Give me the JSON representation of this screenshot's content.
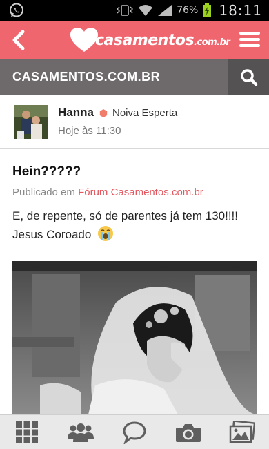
{
  "status_bar": {
    "battery_percent": "76%",
    "time": "18:11",
    "icons": [
      "whatsapp-icon",
      "vibrate-icon",
      "wifi-icon",
      "signal-icon",
      "battery-icon"
    ]
  },
  "app_header": {
    "brand": "casamentos",
    "brand_suffix": ".com.br",
    "icons": [
      "back-arrow-icon",
      "heart-logo-icon",
      "hamburger-menu-icon"
    ]
  },
  "section": {
    "title": "CASAMENTOS.COM.BR",
    "icon": "search-icon"
  },
  "author": {
    "name": "Hanna",
    "badge": "Noiva Esperta",
    "posted": "Hoje às 11:30"
  },
  "post": {
    "title": "Hein?????",
    "published_prefix": "Publicado em",
    "forum_link": "Fórum Casamentos.com.br",
    "body_line1": "E, de repente, só de parentes já tem 130!!!!",
    "body_line2": "Jesus Coroado",
    "emoji": "crying-emoji-icon"
  },
  "bottom_nav": {
    "icons": [
      "grid-icon",
      "community-icon",
      "chat-icon",
      "camera-icon",
      "photos-icon"
    ]
  },
  "colors": {
    "brand": "#f0666f",
    "section_bar": "#6e6a6c",
    "link": "#e4575f",
    "badge": "#f07c6c"
  }
}
